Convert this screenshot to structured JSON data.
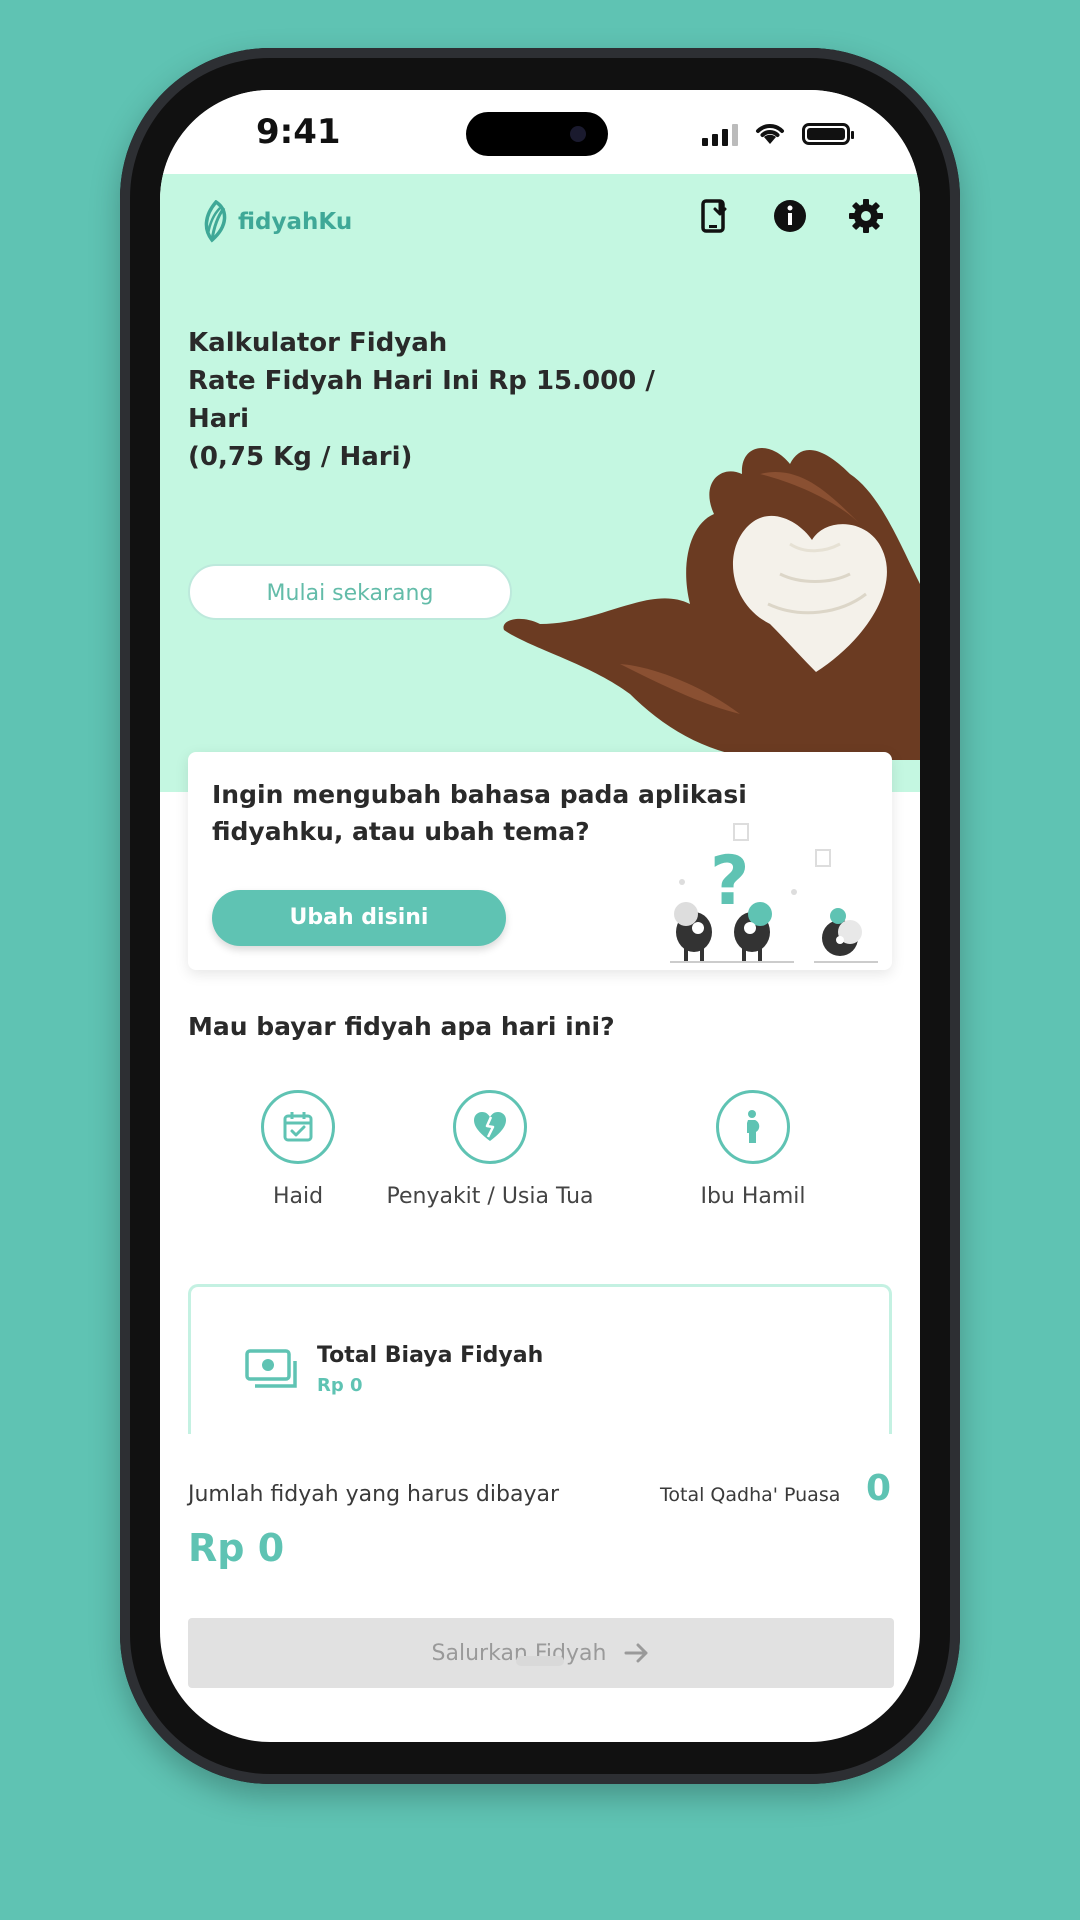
{
  "status_bar": {
    "time": "9:41"
  },
  "header": {
    "logo_text": "fidyahKu"
  },
  "hero": {
    "title": "Kalkulator Fidyah",
    "rate_line": "Rate Fidyah Hari Ini Rp 15.000 / Hari",
    "rate_weight": "(0,75 Kg / Hari)",
    "start_button": "Mulai sekarang"
  },
  "language_card": {
    "text": "Ingin mengubah bahasa pada aplikasi fidyahku, atau ubah tema?",
    "button": "Ubah disini"
  },
  "categories": {
    "question": "Mau bayar fidyah apa hari ini?",
    "items": [
      {
        "label": "Haid",
        "icon": "calendar-check-icon"
      },
      {
        "label": "Penyakit / Usia Tua",
        "icon": "broken-heart-icon"
      },
      {
        "label": "Ibu Hamil",
        "icon": "pregnant-woman-icon"
      }
    ]
  },
  "total_card": {
    "title": "Total Biaya Fidyah",
    "value": "Rp 0"
  },
  "summary": {
    "jumlah_label": "Jumlah fidyah yang harus dibayar",
    "jumlah_value": "Rp 0",
    "qadha_label": "Total Qadha' Puasa",
    "qadha_value": "0"
  },
  "action": {
    "salurkan_label": "Salurkan Fidyah"
  },
  "colors": {
    "accent": "#5fc3b3",
    "hero_bg": "#c4f7e1",
    "page_bg": "#5fc3b3",
    "disabled_bg": "#e1e1e1"
  }
}
